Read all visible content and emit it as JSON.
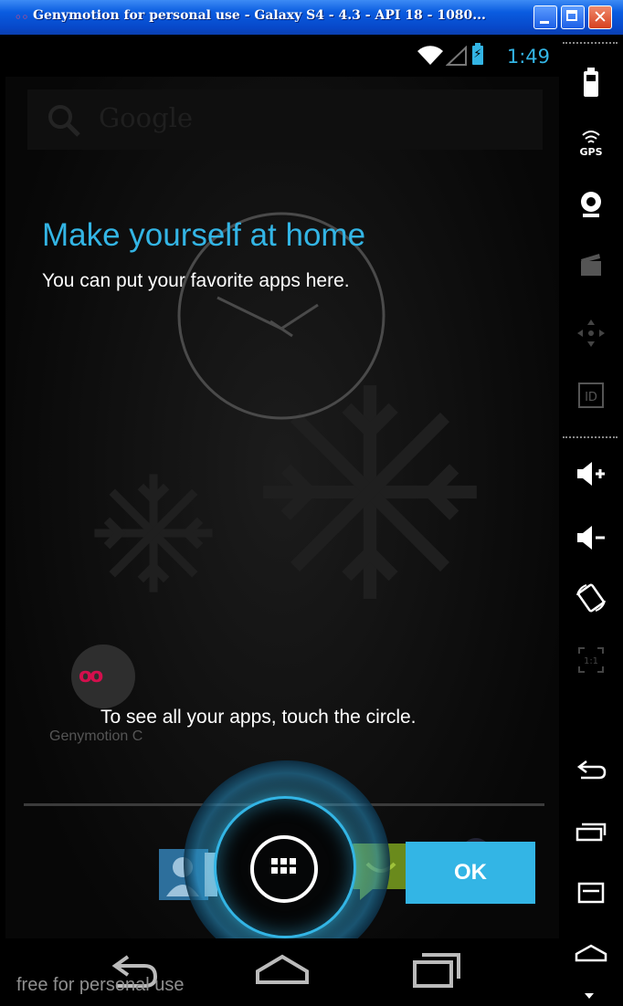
{
  "window": {
    "title": "Genymotion for personal use - Galaxy S4 - 4.3 - API 18 - 1080...",
    "close_glyph": "✕"
  },
  "statusbar": {
    "time": "1:49"
  },
  "search": {
    "placeholder": "Google"
  },
  "cling": {
    "headline": "Make yourself at home",
    "subline": "You can put your favorite apps here.",
    "hint": "To see all your apps, touch the circle.",
    "ok_label": "OK"
  },
  "home": {
    "app_label": "Genymotion C",
    "app_glyph": "oo"
  },
  "watermark": "free for personal use",
  "toolbar": {
    "gps_label": "GPS",
    "id_label": "ID",
    "pixel_perfect_label": "1:1",
    "items": [
      "battery-icon",
      "gps-icon",
      "camera-icon",
      "capture-icon",
      "remote-control-icon",
      "id-icon",
      "volume-up-icon",
      "volume-down-icon",
      "rotate-icon",
      "pixel-perfect-icon",
      "back-icon",
      "recent-apps-icon",
      "menu-icon",
      "home-icon"
    ]
  },
  "colors": {
    "accent": "#33b5e5",
    "titlebar": "#0a5ce0",
    "close": "#d6401e"
  }
}
